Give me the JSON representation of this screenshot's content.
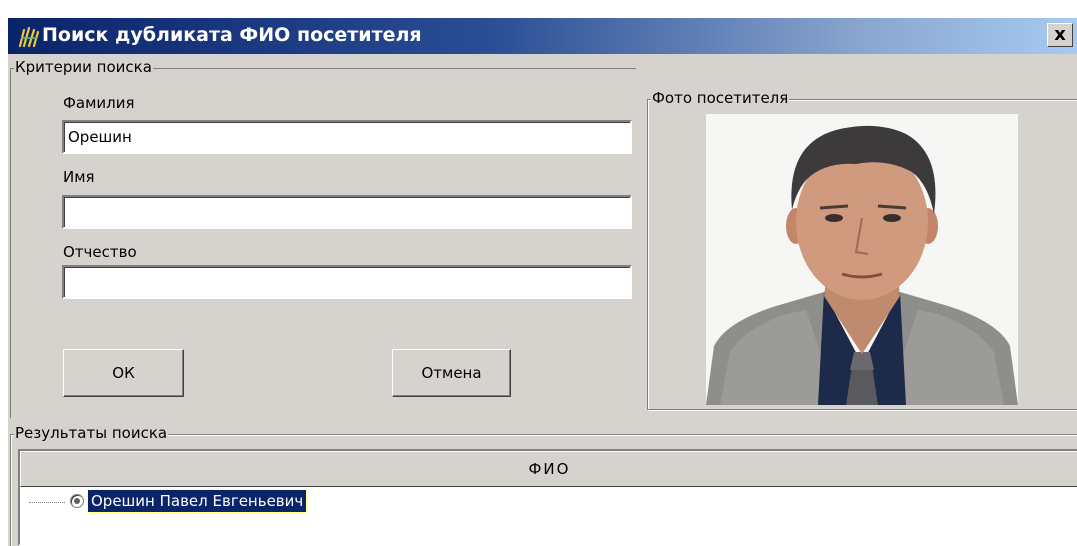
{
  "window": {
    "title": "Поиск дубликата ФИО посетителя",
    "close_label": "x"
  },
  "criteria": {
    "group_label": "Критерии поиска",
    "last_name_label": "Фамилия",
    "last_name_value": "Орешин",
    "first_name_label": "Имя",
    "first_name_value": "",
    "middle_name_label": "Отчество",
    "middle_name_value": "",
    "ok_label": "ОК",
    "cancel_label": "Отмена"
  },
  "photo": {
    "group_label": "Фото посетителя"
  },
  "results": {
    "group_label": "Результаты поиска",
    "column_header": "ФИО",
    "rows": [
      {
        "name": "Орешин Павел Евгеньевич",
        "selected": true
      }
    ]
  },
  "colors": {
    "title_gradient_start": "#0a246a",
    "title_gradient_end": "#a6caf0",
    "face": "#d6d3ce",
    "selection": "#0a246a"
  }
}
